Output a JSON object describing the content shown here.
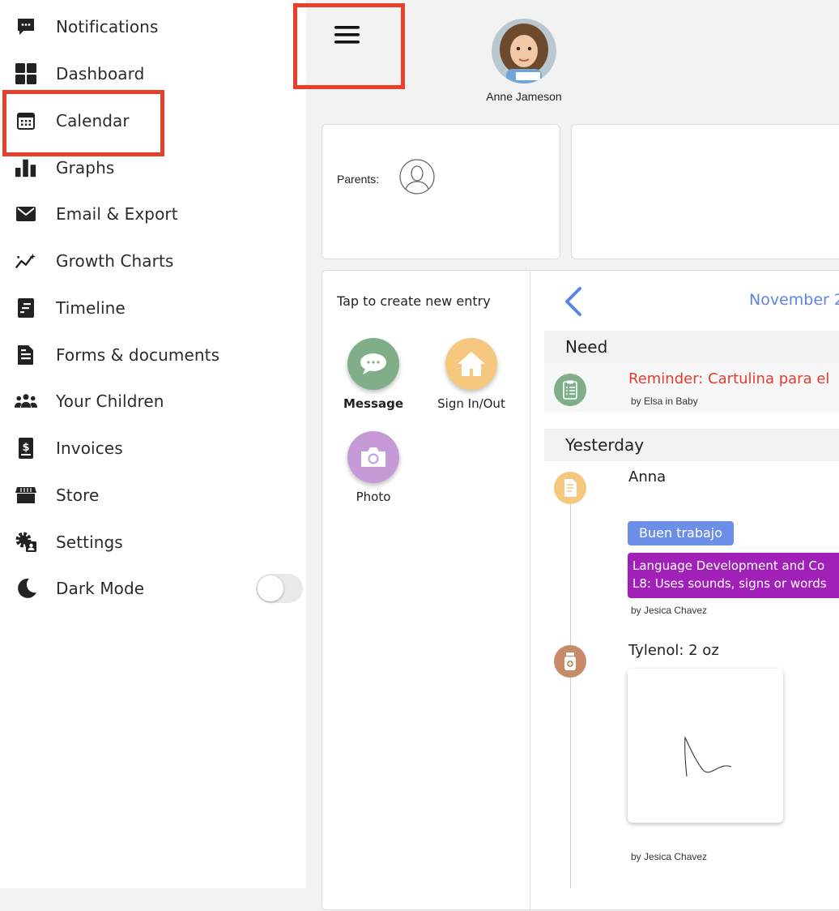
{
  "sidebar": {
    "items": [
      {
        "label": "Notifications",
        "icon": "chat-bubble-icon"
      },
      {
        "label": "Dashboard",
        "icon": "grid-icon"
      },
      {
        "label": "Calendar",
        "icon": "calendar-icon"
      },
      {
        "label": "Graphs",
        "icon": "bar-chart-icon"
      },
      {
        "label": "Email & Export",
        "icon": "envelope-icon"
      },
      {
        "label": "Growth Charts",
        "icon": "trend-sparkle-icon"
      },
      {
        "label": "Timeline",
        "icon": "timeline-doc-icon"
      },
      {
        "label": "Forms & documents",
        "icon": "document-icon"
      },
      {
        "label": "Your Children",
        "icon": "group-icon"
      },
      {
        "label": "Invoices",
        "icon": "invoice-dollar-icon"
      },
      {
        "label": "Store",
        "icon": "storefront-icon"
      },
      {
        "label": "Settings",
        "icon": "gear-person-icon"
      },
      {
        "label": "Dark Mode",
        "icon": "moon-icon"
      }
    ],
    "dark_mode_enabled": false
  },
  "header": {
    "child_name": "Anne Jameson"
  },
  "parents_card": {
    "label": "Parents:"
  },
  "entry_panel": {
    "title": "Tap to create new entry",
    "buttons": [
      {
        "label": "Message",
        "icon": "message-bubble-icon",
        "color": "#7fae88"
      },
      {
        "label": "Sign In/Out",
        "icon": "house-icon",
        "color": "#f6c77e"
      },
      {
        "label": "Photo",
        "icon": "camera-icon",
        "color": "#c59ad6"
      }
    ]
  },
  "feed": {
    "date_label": "November 2",
    "sections": [
      {
        "title": "Need",
        "entries": [
          {
            "title": "Reminder: Cartulina para el ",
            "by": "by Elsa in Baby",
            "icon": "checklist-icon",
            "icon_color": "#7fae88",
            "title_color": "#e53b2f"
          }
        ]
      },
      {
        "title": "Yesterday",
        "entries": [
          {
            "title": "Anna",
            "tag": "Buen trabajo",
            "tag_color": "#6b8fe8",
            "milestone_line1": "Language Development and Co",
            "milestone_line2": "L8: Uses sounds, signs or words",
            "milestone_color": "#a020b8",
            "by": "by Jesica Chavez",
            "icon": "note-icon",
            "icon_color": "#f6c77e"
          },
          {
            "title": "Tylenol: 2 oz",
            "by": "by Jesica Chavez",
            "icon": "medicine-icon",
            "icon_color": "#c98a6a"
          }
        ]
      }
    ]
  },
  "colors": {
    "accent_blue": "#5b86e5",
    "highlight_red": "#e8402a"
  }
}
